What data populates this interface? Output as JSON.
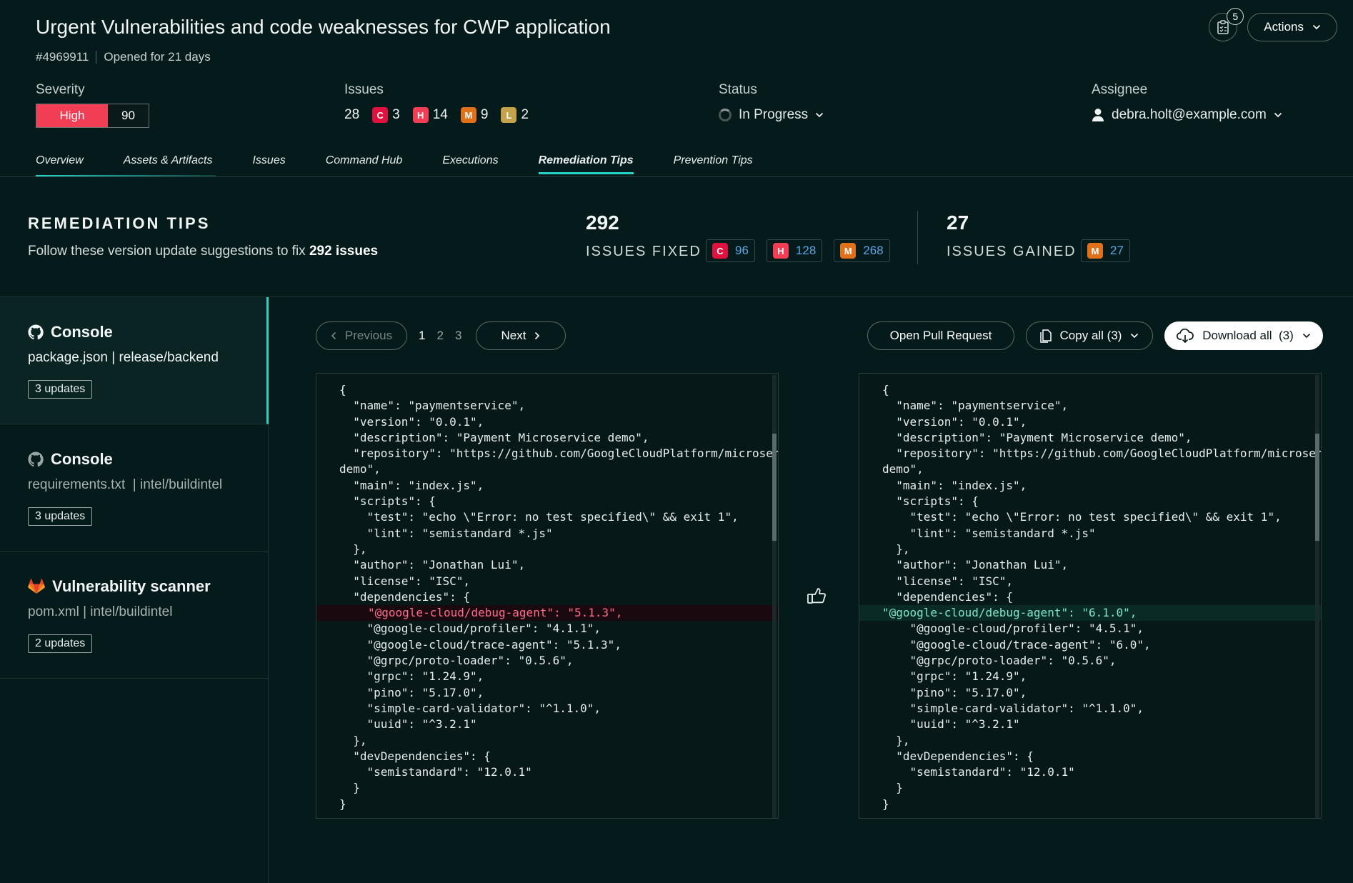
{
  "header": {
    "title": "Urgent Vulnerabilities and code weaknesses for CWP application",
    "id": "#4969911",
    "opened": "Opened for 21 days",
    "notification_count": "5",
    "actions_label": "Actions"
  },
  "severity": {
    "label": "Severity",
    "level": "High",
    "score": "90"
  },
  "issues": {
    "label": "Issues",
    "total": "28",
    "critical": "3",
    "high": "14",
    "medium": "9",
    "low": "2"
  },
  "status": {
    "label": "Status",
    "value": "In Progress"
  },
  "assignee": {
    "label": "Assignee",
    "value": "debra.holt@example.com"
  },
  "tabs": [
    {
      "label": "Overview"
    },
    {
      "label": "Assets & Artifacts"
    },
    {
      "label": "Issues"
    },
    {
      "label": "Command Hub"
    },
    {
      "label": "Executions"
    },
    {
      "label": "Remediation Tips"
    },
    {
      "label": "Prevention Tips"
    }
  ],
  "remediation": {
    "title": "REMEDIATION TIPS",
    "subtitle_prefix": "Follow these version update suggestions to fix ",
    "subtitle_bold": "292 issues",
    "fixed_total": "292",
    "fixed_label": "ISSUES FIXED",
    "fixed_critical": "96",
    "fixed_high": "128",
    "fixed_medium": "268",
    "gained_total": "27",
    "gained_label": "ISSUES GAINED",
    "gained_medium": "27"
  },
  "chip_letters": {
    "c": "C",
    "h": "H",
    "m": "M",
    "l": "L"
  },
  "repos": [
    {
      "name": "Console",
      "path": "package.json | release/backend",
      "updates": "3 updates",
      "icon": "github-icon"
    },
    {
      "name": "Console",
      "path": "requirements.txt  | intel/buildintel",
      "updates": "3 updates",
      "icon": "github-icon"
    },
    {
      "name": "Vulnerability scanner",
      "path": "pom.xml | intel/buildintel",
      "updates": "2 updates",
      "icon": "gitlab-icon"
    }
  ],
  "toolbar": {
    "previous": "Previous",
    "next": "Next",
    "pages": [
      "1",
      "2",
      "3"
    ],
    "open_pr": "Open Pull Request",
    "copy_all": "Copy all (3)",
    "download_all": "Download all  (3)"
  },
  "code_left": [
    "{",
    "  \"name\": \"paymentservice\",",
    "  \"version\": \"0.0.1\",",
    "  \"description\": \"Payment Microservice demo\",",
    "  \"repository\": \"https://github.com/GoogleCloudPlatform/microservices-",
    "demo\",",
    "  \"main\": \"index.js\",",
    "  \"scripts\": {",
    "    \"test\": \"echo \\\"Error: no test specified\\\" && exit 1\",",
    "    \"lint\": \"semistandard *.js\"",
    "  },",
    "  \"author\": \"Jonathan Lui\",",
    "  \"license\": \"ISC\",",
    "  \"dependencies\": {",
    "\"@google-cloud/debug-agent\": \"5.1.3\",",
    "    \"@google-cloud/profiler\": \"4.1.1\",",
    "    \"@google-cloud/trace-agent\": \"5.1.3\",",
    "    \"@grpc/proto-loader\": \"0.5.6\",",
    "    \"grpc\": \"1.24.9\",",
    "    \"pino\": \"5.17.0\",",
    "    \"simple-card-validator\": \"^1.1.0\",",
    "    \"uuid\": \"^3.2.1\"",
    "  },",
    "  \"devDependencies\": {",
    "    \"semistandard\": \"12.0.1\"",
    "  }",
    "}"
  ],
  "code_right": [
    "{",
    "  \"name\": \"paymentservice\",",
    "  \"version\": \"0.0.1\",",
    "  \"description\": \"Payment Microservice demo\",",
    "  \"repository\": \"https://github.com/GoogleCloudPlatform/microservices-",
    "demo\",",
    "  \"main\": \"index.js\",",
    "  \"scripts\": {",
    "    \"test\": \"echo \\\"Error: no test specified\\\" && exit 1\",",
    "    \"lint\": \"semistandard *.js\"",
    "  },",
    "  \"author\": \"Jonathan Lui\",",
    "  \"license\": \"ISC\",",
    "  \"dependencies\": {",
    "\"@google-cloud/debug-agent\": \"6.1.0\",",
    "    \"@google-cloud/profiler\": \"4.5.1\",",
    "    \"@google-cloud/trace-agent\": \"6.0\",",
    "    \"@grpc/proto-loader\": \"0.5.6\",",
    "    \"grpc\": \"1.24.9\",",
    "    \"pino\": \"5.17.0\",",
    "    \"simple-card-validator\": \"^1.1.0\",",
    "    \"uuid\": \"^3.2.1\"",
    "  },",
    "  \"devDependencies\": {",
    "    \"semistandard\": \"12.0.1\"",
    "  }",
    "}"
  ],
  "colors": {
    "accent": "#25d4c6",
    "critical": "#e0103f",
    "high": "#f23e54",
    "medium": "#e0701a",
    "low": "#c4a24a",
    "background": "#051a1a"
  }
}
